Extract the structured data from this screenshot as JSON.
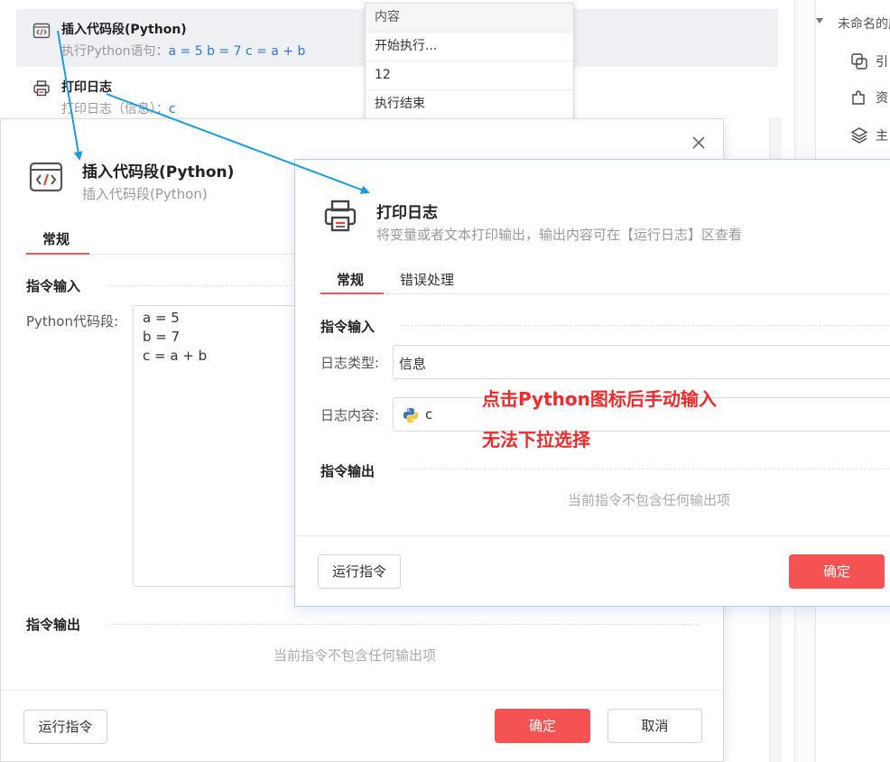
{
  "flow": {
    "items": [
      {
        "title": "插入代码段(Python)",
        "desc_prefix": "执行Python语句：",
        "desc_code": "a = 5 b = 7 c = a + b"
      },
      {
        "title": "打印日志",
        "desc_prefix": "打印日志（信息）：",
        "desc_code": "c"
      }
    ]
  },
  "right_panel": {
    "tree_title": "未命名的应",
    "items": [
      {
        "label": "引",
        "icon": "copy-icon"
      },
      {
        "label": "资",
        "icon": "puzzle-icon"
      },
      {
        "label": "主",
        "icon": "layers-icon"
      }
    ]
  },
  "dropdown": {
    "header": "内容",
    "rows": [
      "开始执行...",
      "12",
      "执行结束"
    ]
  },
  "dialog_python": {
    "icon": "code-icon",
    "title": "插入代码段(Python)",
    "subtitle": "插入代码段(Python)",
    "tab": "常规",
    "section_input": "指令输入",
    "code_label": "Python代码段:",
    "code_lines": [
      "a = 5",
      "b = 7",
      "c = a + b"
    ],
    "section_output": "指令输出",
    "output_empty": "当前指令不包含任何输出项",
    "run_label": "运行指令",
    "confirm_label": "确定",
    "cancel_label": "取消"
  },
  "dialog_log": {
    "icon": "printer-icon",
    "title": "打印日志",
    "subtitle": "将变量或者文本打印输出，输出内容可在【运行日志】区查看",
    "tabs": [
      "常规",
      "错误处理"
    ],
    "section_input": "指令输入",
    "log_type_label": "日志类型:",
    "log_type_value": "信息",
    "log_content_label": "日志内容:",
    "log_content_value": "c",
    "section_output": "指令输出",
    "output_empty": "当前指令不包含任何输出项",
    "run_label": "运行指令",
    "confirm_label": "确定"
  },
  "annotation": {
    "line1": "点击Python图标后手动输入",
    "line2": "无法下拉选择",
    "color": "#ee2b2b"
  },
  "colors": {
    "accent": "#f55353",
    "arrow": "#1a9be0",
    "link": "#2b78d6"
  }
}
